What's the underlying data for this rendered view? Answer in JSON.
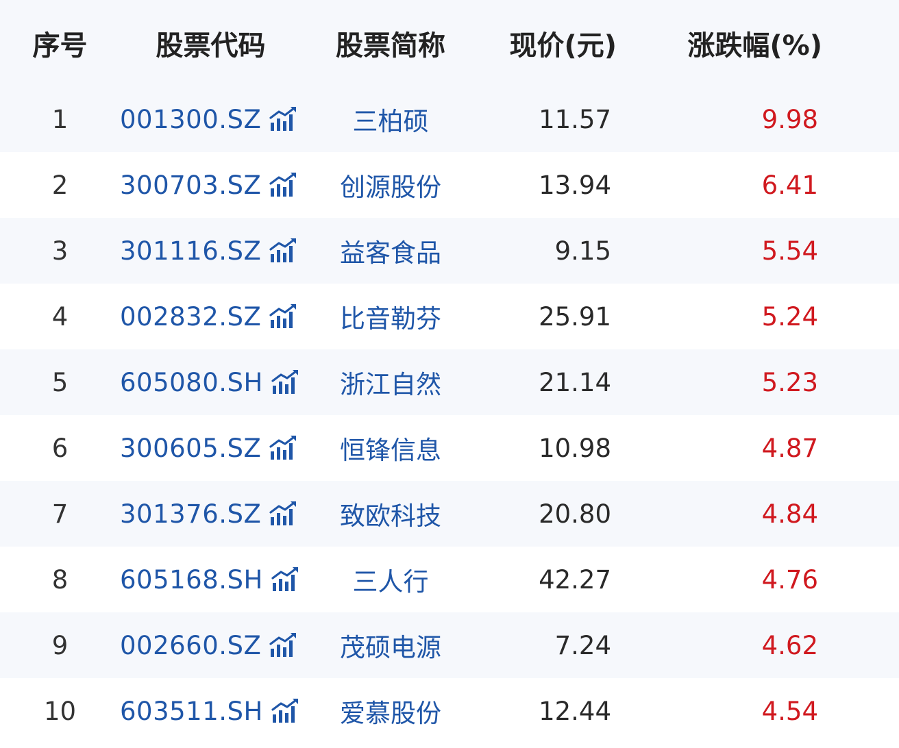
{
  "colors": {
    "header_bg": "#f6f8fc",
    "stripe_bg": "#f6f8fc",
    "code_blue": "#1f56a8",
    "rise_red": "#d0191f",
    "text_dark": "#222222"
  },
  "columns": {
    "index": "序号",
    "code": "股票代码",
    "name": "股票简称",
    "price": "现价(元)",
    "change": "涨跌幅(%)"
  },
  "rows": [
    {
      "index": "1",
      "code": "001300.SZ",
      "name": "三柏硕",
      "price": "11.57",
      "change": "9.98",
      "icon": "trend-chart-icon"
    },
    {
      "index": "2",
      "code": "300703.SZ",
      "name": "创源股份",
      "price": "13.94",
      "change": "6.41",
      "icon": "trend-chart-icon"
    },
    {
      "index": "3",
      "code": "301116.SZ",
      "name": "益客食品",
      "price": "9.15",
      "change": "5.54",
      "icon": "trend-chart-icon"
    },
    {
      "index": "4",
      "code": "002832.SZ",
      "name": "比音勒芬",
      "price": "25.91",
      "change": "5.24",
      "icon": "trend-chart-icon"
    },
    {
      "index": "5",
      "code": "605080.SH",
      "name": "浙江自然",
      "price": "21.14",
      "change": "5.23",
      "icon": "trend-chart-icon"
    },
    {
      "index": "6",
      "code": "300605.SZ",
      "name": "恒锋信息",
      "price": "10.98",
      "change": "4.87",
      "icon": "trend-chart-icon"
    },
    {
      "index": "7",
      "code": "301376.SZ",
      "name": "致欧科技",
      "price": "20.80",
      "change": "4.84",
      "icon": "trend-chart-icon"
    },
    {
      "index": "8",
      "code": "605168.SH",
      "name": "三人行",
      "price": "42.27",
      "change": "4.76",
      "icon": "trend-chart-icon"
    },
    {
      "index": "9",
      "code": "002660.SZ",
      "name": "茂硕电源",
      "price": "7.24",
      "change": "4.62",
      "icon": "trend-chart-icon"
    },
    {
      "index": "10",
      "code": "603511.SH",
      "name": "爱慕股份",
      "price": "12.44",
      "change": "4.54",
      "icon": "trend-chart-icon"
    }
  ]
}
